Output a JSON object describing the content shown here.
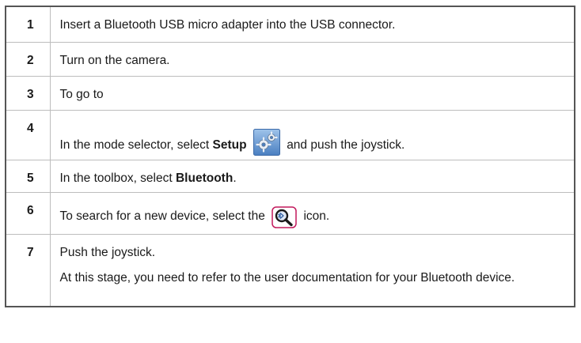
{
  "steps": [
    {
      "num": "1",
      "text": "Insert a Bluetooth USB micro adapter into the USB connector."
    },
    {
      "num": "2",
      "text": "Turn on the camera."
    },
    {
      "num": "3",
      "text": "To go to"
    },
    {
      "num": "4",
      "before": "In the mode selector, select ",
      "bold": "Setup",
      "after": " and push the joystick.",
      "icon": "setup-gear-icon"
    },
    {
      "num": "5",
      "before": "In the toolbox, select ",
      "bold": "Bluetooth",
      "after": "."
    },
    {
      "num": "6",
      "before": "To search for a new device, select the ",
      "after": " icon.",
      "icon": "bluetooth-search-icon"
    },
    {
      "num": "7",
      "text": "Push the joystick.",
      "text2": "At this stage, you need to refer to the user documentation for your Bluetooth device."
    }
  ],
  "colors": {
    "border": "#555555",
    "rule": "#bdbdbd",
    "icon_blue": "#4a7fc1",
    "icon_pink": "#c2185b"
  }
}
